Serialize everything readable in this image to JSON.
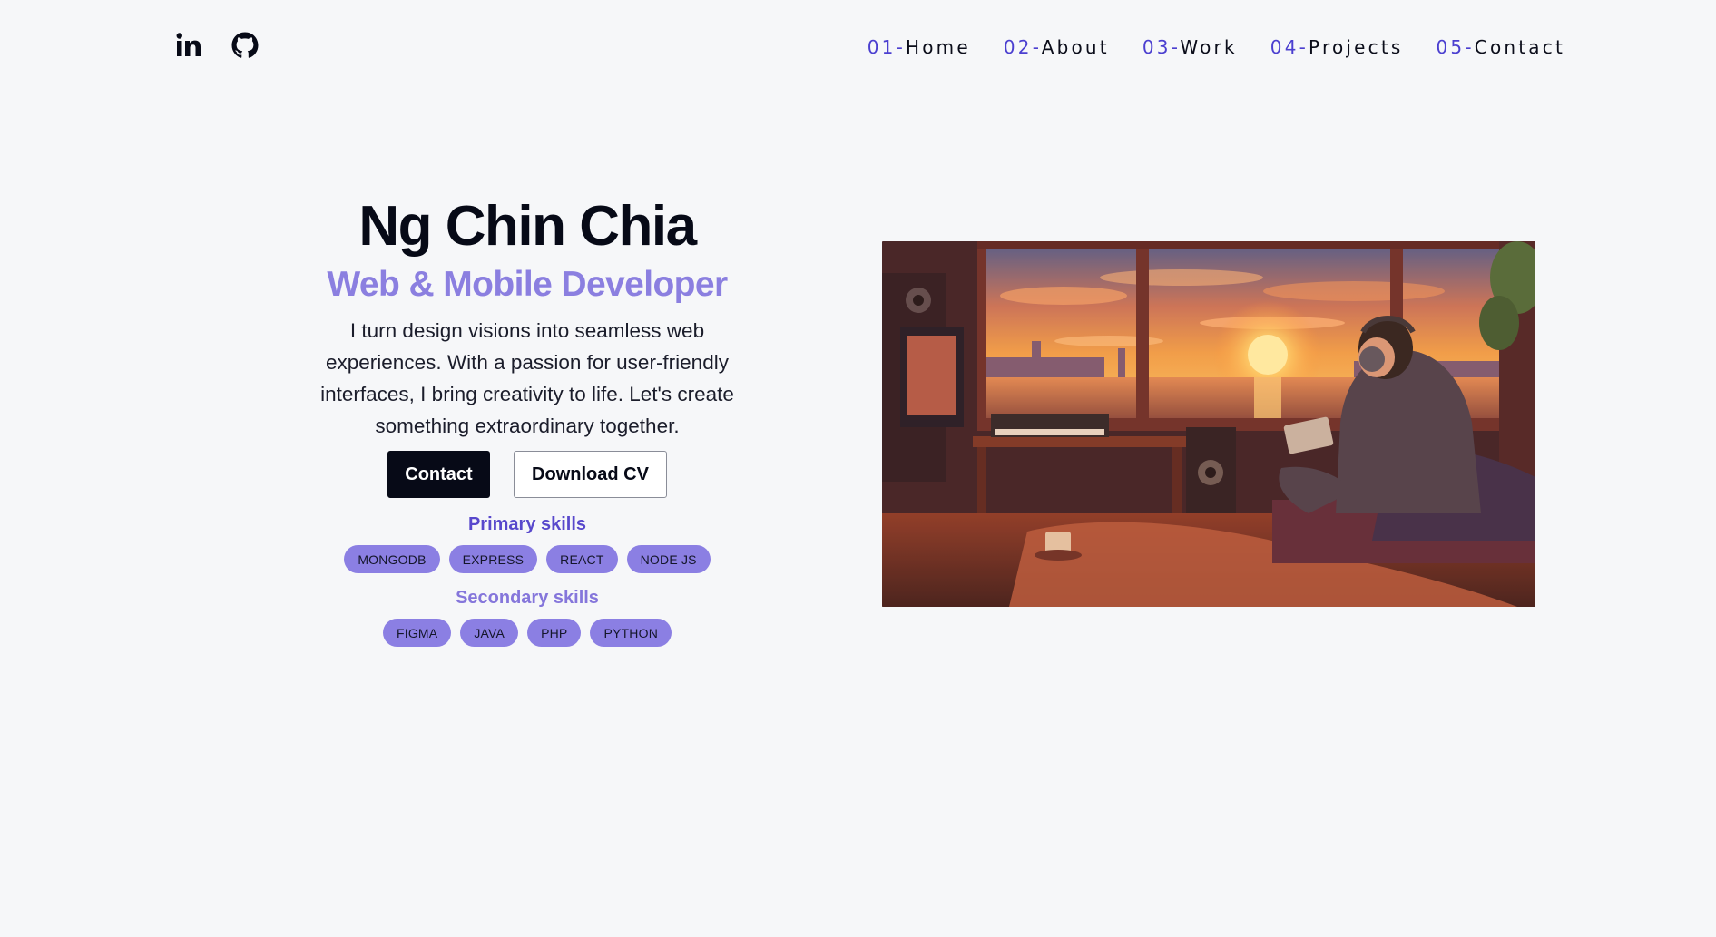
{
  "header": {
    "socials": [
      {
        "icon": "linkedin-icon"
      },
      {
        "icon": "github-icon"
      }
    ],
    "nav": [
      {
        "num": "01-",
        "label": "Home"
      },
      {
        "num": "02-",
        "label": "About"
      },
      {
        "num": "03-",
        "label": "Work"
      },
      {
        "num": "04-",
        "label": "Projects"
      },
      {
        "num": "05-",
        "label": "Contact"
      }
    ]
  },
  "hero": {
    "name": "Ng Chin Chia",
    "role": "Web & Mobile Developer",
    "bio": "I turn design visions into seamless web experiences. With a passion for user-friendly interfaces, I bring creativity to life. Let's create something extraordinary together.",
    "contact_label": "Contact",
    "download_label": "Download CV",
    "primary_skills_title": "Primary skills",
    "primary_skills": [
      "MONGODB",
      "EXPRESS",
      "REACT",
      "NODE JS"
    ],
    "secondary_skills_title": "Secondary skills",
    "secondary_skills": [
      "FIGMA",
      "JAVA",
      "PHP",
      "PYTHON"
    ]
  },
  "colors": {
    "accent": "#4b3fd0",
    "role": "#8b7fe0",
    "chip": "#8b7fe3",
    "background": "#f6f7f9",
    "dark": "#070a17"
  }
}
